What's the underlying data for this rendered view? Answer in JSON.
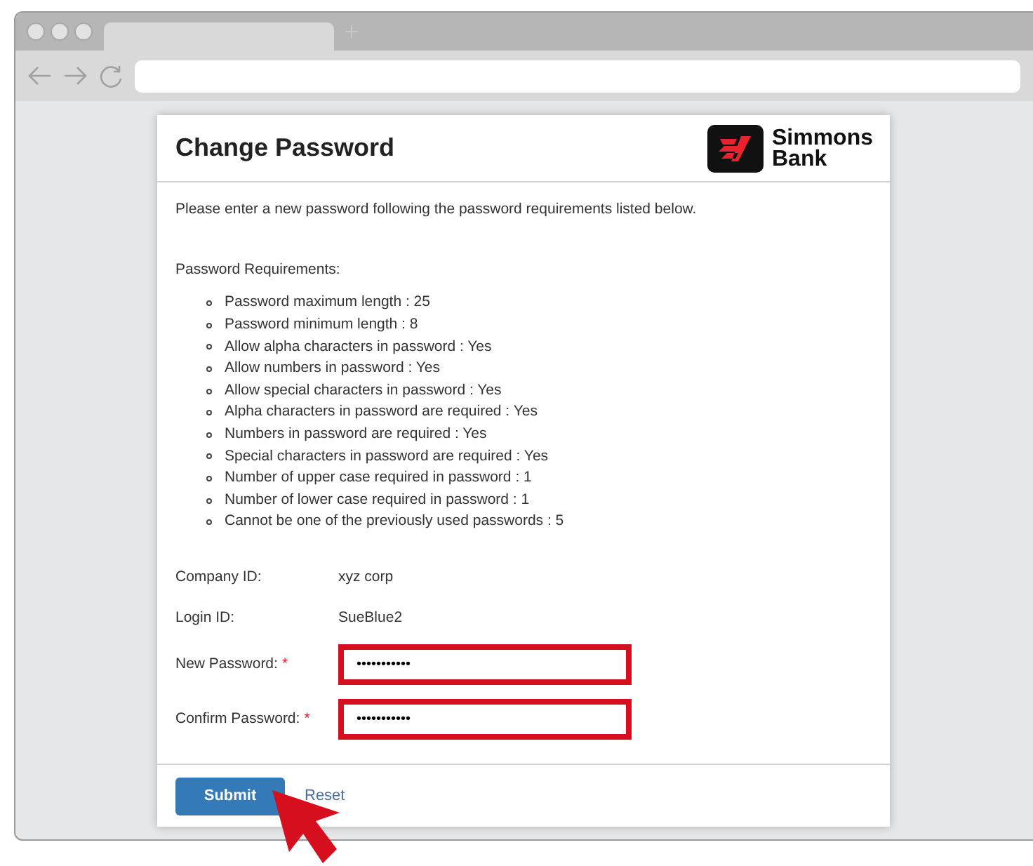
{
  "page": {
    "title": "Change Password",
    "logo": {
      "line_1": "Simmons",
      "line_2": "Bank"
    },
    "intro": "Please enter a new password following the password requirements listed below.",
    "requirements_heading": "Password Requirements:",
    "requirements": [
      "Password maximum length : 25",
      "Password minimum length : 8",
      "Allow alpha characters in password : Yes",
      "Allow numbers in password : Yes",
      "Allow special characters in password : Yes",
      "Alpha characters in password are required : Yes",
      "Numbers in password are required : Yes",
      "Special characters in password are required : Yes",
      "Number of upper case required in password : 1",
      "Number of lower case required in password : 1",
      "Cannot be one of the previously used passwords : 5"
    ],
    "info": [
      {
        "label": "Company ID:",
        "value": "xyz corp"
      },
      {
        "label": "Login ID:",
        "value": "SueBlue2"
      }
    ],
    "fields": [
      {
        "label": "New Password:",
        "required_mark": "*",
        "value": "•••••••••••",
        "highlighted": true
      },
      {
        "label": "Confirm Password:",
        "required_mark": "*",
        "value": "•••••••••••",
        "highlighted": true
      }
    ],
    "buttons": [
      {
        "kind": "primary",
        "label": "Submit"
      },
      {
        "kind": "link",
        "label": "Reset"
      }
    ]
  }
}
